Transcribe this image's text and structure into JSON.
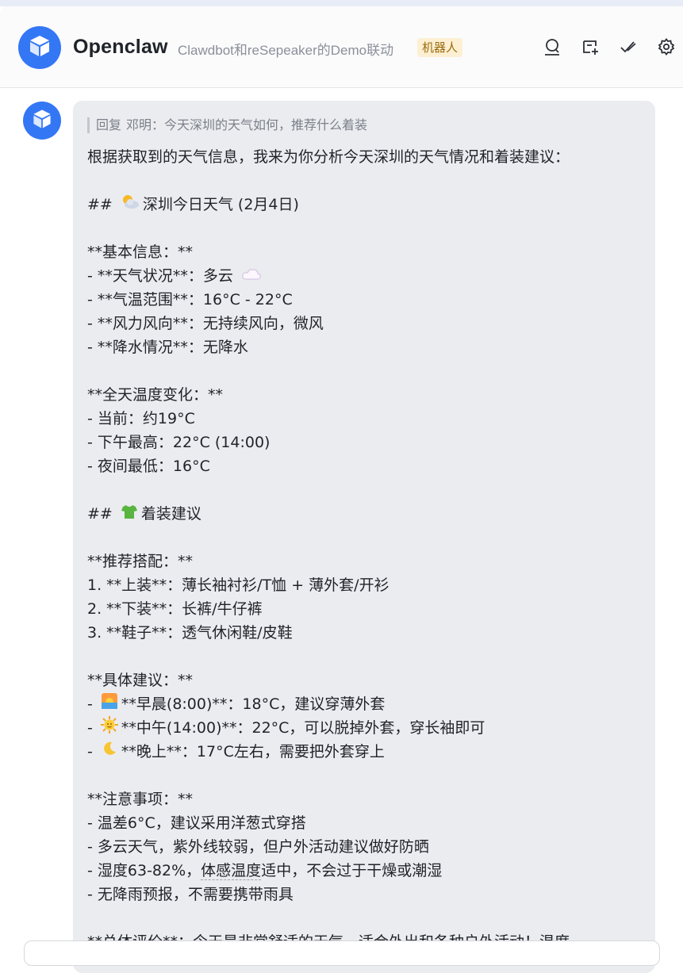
{
  "header": {
    "title": "Openclaw",
    "subtitle": "Clawdbot和reSepeaker的Demo联动",
    "badge": "机器人",
    "icons": [
      "search-icon",
      "add-chat-icon",
      "check-icon",
      "settings-icon"
    ]
  },
  "message": {
    "reply_label": "回复",
    "reply_to": "邓明：今天深圳的天气如何，推荐什么着装",
    "intro": "根据获取到的天气信息，我来为你分析今天深圳的天气情况和着装建议：",
    "section1": {
      "prefix": "##",
      "emoji": "sun-behind-cloud-emoji",
      "text": "深圳今日天气 (2月4日)"
    },
    "basic_title": "**基本信息：**",
    "basic": [
      {
        "text": "- **天气状况**：多云",
        "emoji": "cloud-emoji"
      },
      {
        "text": "- **气温范围**：16°C - 22°C"
      },
      {
        "text": "- **风力风向**：无持续风向，微风"
      },
      {
        "text": "- **降水情况**：无降水"
      }
    ],
    "temp_title": "**全天温度变化：**",
    "temp": [
      "- 当前：约19°C",
      "- 下午最高：22°C (14:00)",
      "- 夜间最低：16°C"
    ],
    "section2": {
      "prefix": "##",
      "emoji": "tshirt-emoji",
      "text": "着装建议"
    },
    "outfit_title": "**推荐搭配：**",
    "outfit": [
      "1. **上装**：薄长袖衬衫/T恤 + 薄外套/开衫",
      "2. **下装**：长裤/牛仔裤",
      "3. **鞋子**：透气休闲鞋/皮鞋"
    ],
    "detail_title": "**具体建议：**",
    "detail": [
      {
        "emoji": "sunrise-emoji",
        "text": "**早晨(8:00)**：18°C，建议穿薄外套"
      },
      {
        "emoji": "sun-face-emoji",
        "text": "**中午(14:00)**：22°C，可以脱掉外套，穿长袖即可"
      },
      {
        "emoji": "moon-emoji",
        "text": "**晚上**：17°C左右，需要把外套穿上"
      }
    ],
    "notes_title": "**注意事项：**",
    "notes": [
      "- 温差6°C，建议采用洋葱式穿搭",
      "- 多云天气，紫外线较弱，但户外活动建议做好防晒"
    ],
    "humidity": {
      "pre": "- 湿度63-82%，",
      "underlined": "体感温度",
      "post": "适中，不会过于干燥或潮湿"
    },
    "last_note": "- 无降雨预报，不需要携带雨具",
    "summary_partial": "**总体评价**：今天是非常舒适的天气，适合外出和各种户外活动！温度"
  },
  "colors": {
    "accent": "#3477f5",
    "bubble": "#ebecef",
    "badge_bg": "#fdf0d2"
  }
}
